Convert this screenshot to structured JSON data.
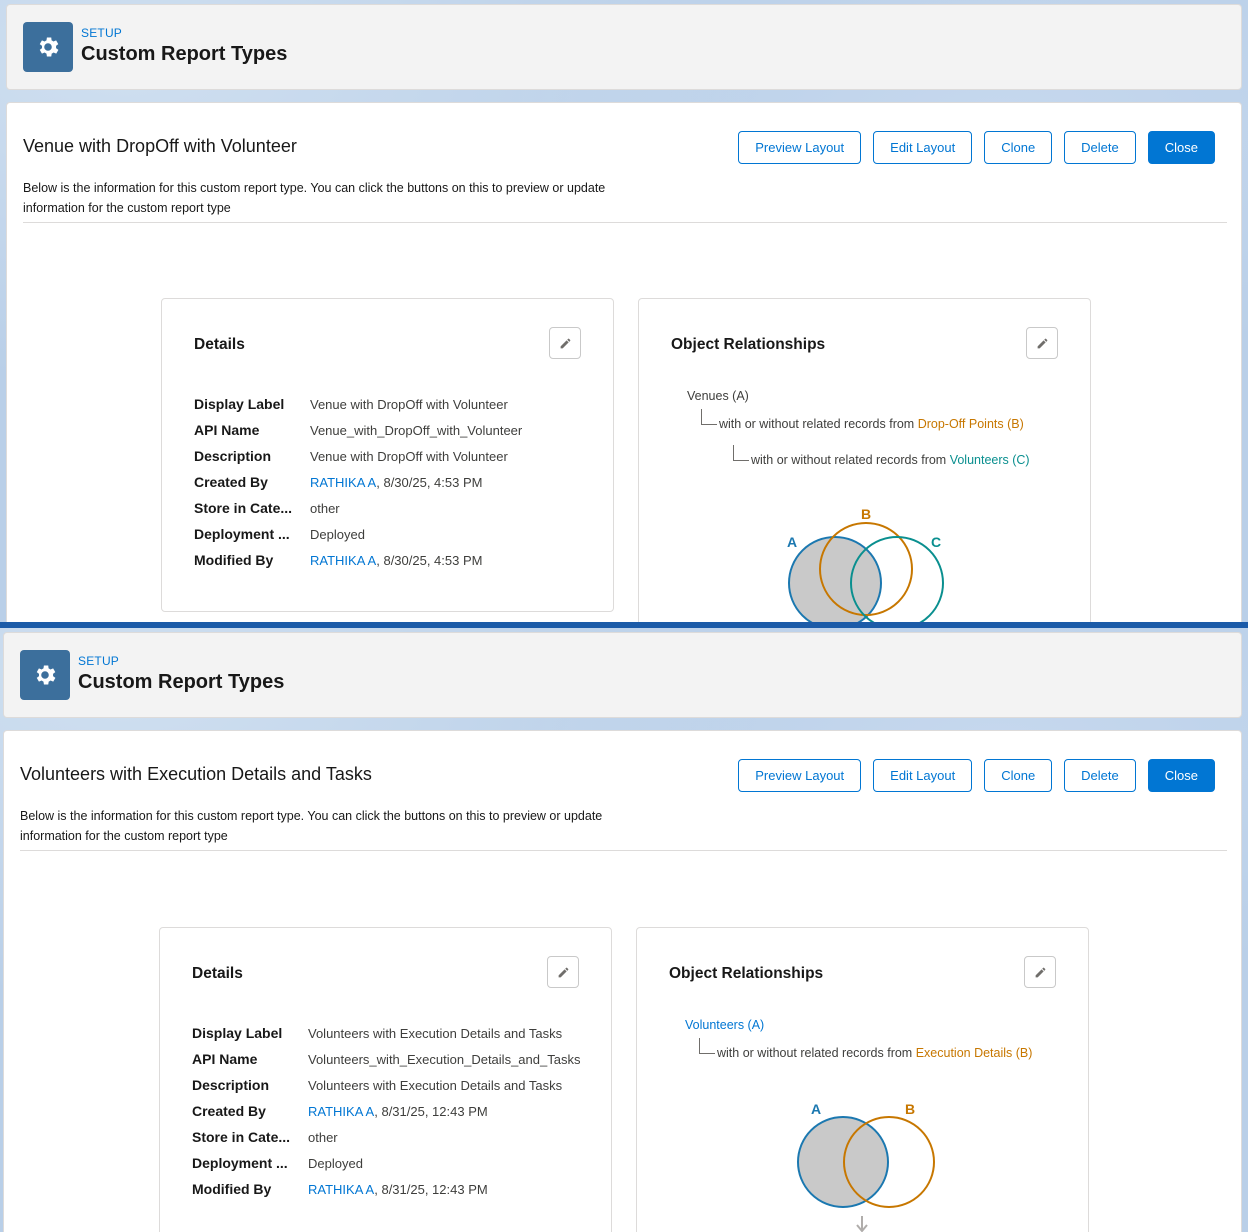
{
  "screens": [
    {
      "header": {
        "setup_label": "SETUP",
        "title": "Custom Report Types"
      },
      "report_type": {
        "title": "Venue with DropOff with Volunteer",
        "description": "Below is the information for this custom report type. You can click the buttons on this to preview or update information for the custom report type"
      },
      "buttons": {
        "preview": "Preview Layout",
        "edit": "Edit Layout",
        "clone": "Clone",
        "delete": "Delete",
        "close": "Close"
      },
      "details": {
        "title": "Details",
        "fields": [
          {
            "label": "Display Label",
            "value": "Venue with DropOff with Volunteer"
          },
          {
            "label": "API Name",
            "value": "Venue_with_DropOff_with_Volunteer"
          },
          {
            "label": "Description",
            "value": "Venue with DropOff with Volunteer"
          },
          {
            "label": "Created By",
            "link": "RATHIKA A",
            "value": ", 8/30/25, 4:53 PM"
          },
          {
            "label": "Store in Cate...",
            "value": "other"
          },
          {
            "label": "Deployment ...",
            "value": "Deployed"
          },
          {
            "label": "Modified By",
            "link": "RATHIKA A",
            "value": ", 8/30/25, 4:53 PM"
          }
        ]
      },
      "relationships": {
        "title": "Object Relationships",
        "primary": "Venues (A)",
        "connector": "with or without related records from",
        "b": "Drop-Off Points (B)",
        "c": "Volunteers (C)",
        "venn_labels": {
          "a": "A",
          "b": "B",
          "c": "C"
        }
      }
    },
    {
      "header": {
        "setup_label": "SETUP",
        "title": "Custom Report Types"
      },
      "report_type": {
        "title": "Volunteers with Execution Details and Tasks",
        "description": "Below is the information for this custom report type. You can click the buttons on this to preview or update information for the custom report type"
      },
      "buttons": {
        "preview": "Preview Layout",
        "edit": "Edit Layout",
        "clone": "Clone",
        "delete": "Delete",
        "close": "Close"
      },
      "details": {
        "title": "Details",
        "fields": [
          {
            "label": "Display Label",
            "value": "Volunteers with Execution Details and Tasks"
          },
          {
            "label": "API Name",
            "value": "Volunteers_with_Execution_Details_and_Tasks"
          },
          {
            "label": "Description",
            "value": "Volunteers with Execution Details and Tasks"
          },
          {
            "label": "Created By",
            "link": "RATHIKA A",
            "value": ", 8/31/25, 12:43 PM"
          },
          {
            "label": "Store in Cate...",
            "value": "other"
          },
          {
            "label": "Deployment ...",
            "value": "Deployed"
          },
          {
            "label": "Modified By",
            "link": "RATHIKA A",
            "value": ", 8/31/25, 12:43 PM"
          }
        ]
      },
      "relationships": {
        "title": "Object Relationships",
        "primary": "Volunteers (A)",
        "connector": "with or without related records from",
        "b": "Execution Details (B)",
        "venn_labels": {
          "a": "A",
          "b": "B"
        }
      }
    }
  ],
  "colors": {
    "brand": "#0176d3",
    "gear_tile": "#3c6f9c",
    "object_a": "#1b78b0",
    "object_b": "#c77700",
    "object_c": "#0a8f8f"
  },
  "icons": {
    "setup": "gear-icon",
    "edit": "pencil-icon",
    "more": "arrow-down-icon"
  }
}
